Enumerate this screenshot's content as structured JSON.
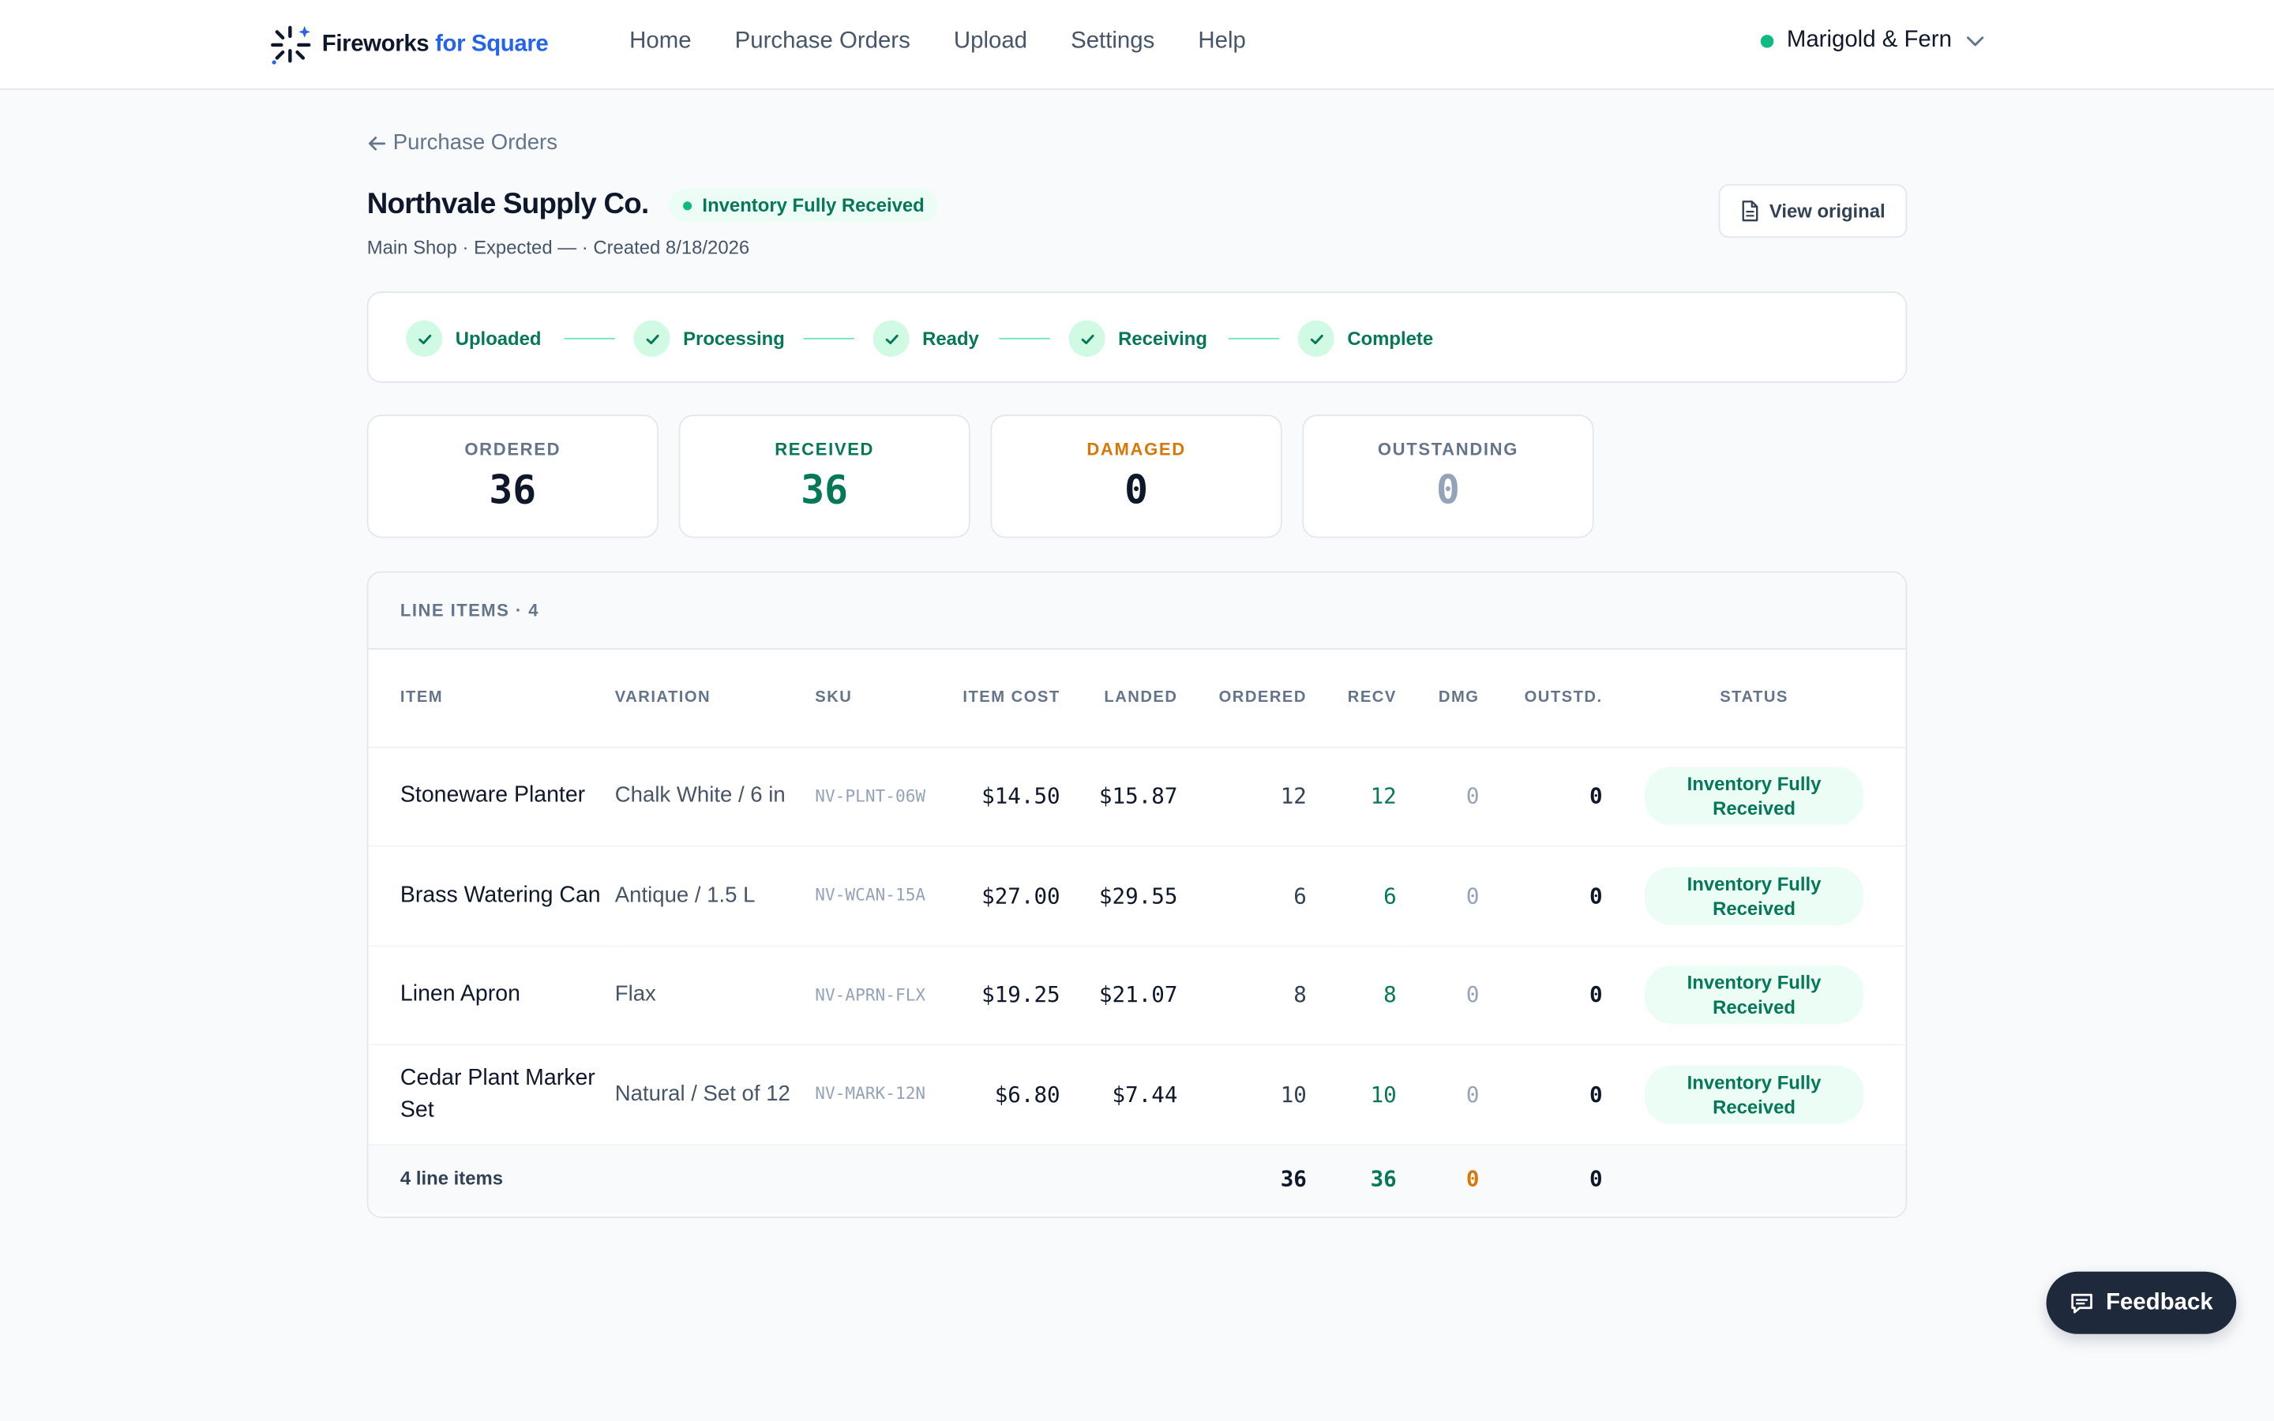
{
  "brand": {
    "name": "Fireworks",
    "accent": "for Square"
  },
  "nav": [
    "Home",
    "Purchase Orders",
    "Upload",
    "Settings",
    "Help"
  ],
  "account": {
    "name": "Marigold & Fern"
  },
  "back_link": "Purchase Orders",
  "header": {
    "title": "Northvale Supply Co.",
    "status": "Inventory Fully Received",
    "subtitle": "Main Shop · Expected — · Created 8/18/2026",
    "view_original": "View original"
  },
  "steps": [
    "Uploaded",
    "Processing",
    "Ready",
    "Receiving",
    "Complete"
  ],
  "stats": {
    "ordered": {
      "label": "ORDERED",
      "value": "36"
    },
    "received": {
      "label": "RECEIVED",
      "value": "36"
    },
    "damaged": {
      "label": "DAMAGED",
      "value": "0"
    },
    "outstanding": {
      "label": "OUTSTANDING",
      "value": "0"
    }
  },
  "table": {
    "title": "LINE ITEMS · 4",
    "columns": {
      "item": "ITEM",
      "variation": "VARIATION",
      "sku": "SKU",
      "item_cost": "ITEM COST",
      "landed": "LANDED",
      "ordered": "ORDERED",
      "recv": "RECV",
      "dmg": "DMG",
      "outstd": "OUTSTD.",
      "status": "STATUS"
    },
    "rows": [
      {
        "item": "Stoneware Planter",
        "variation": "Chalk White / 6 in",
        "sku": "NV-PLNT-06W",
        "cost": "$14.50",
        "landed": "$15.87",
        "ordered": "12",
        "recv": "12",
        "dmg": "0",
        "out": "0",
        "status": "Inventory Fully Received"
      },
      {
        "item": "Brass Watering Can",
        "variation": "Antique / 1.5 L",
        "sku": "NV-WCAN-15A",
        "cost": "$27.00",
        "landed": "$29.55",
        "ordered": "6",
        "recv": "6",
        "dmg": "0",
        "out": "0",
        "status": "Inventory Fully Received"
      },
      {
        "item": "Linen Apron",
        "variation": "Flax",
        "sku": "NV-APRN-FLX",
        "cost": "$19.25",
        "landed": "$21.07",
        "ordered": "8",
        "recv": "8",
        "dmg": "0",
        "out": "0",
        "status": "Inventory Fully Received"
      },
      {
        "item": "Cedar Plant Marker Set",
        "variation": "Natural / Set of 12",
        "sku": "NV-MARK-12N",
        "cost": "$6.80",
        "landed": "$7.44",
        "ordered": "10",
        "recv": "10",
        "dmg": "0",
        "out": "0",
        "status": "Inventory Fully Received"
      }
    ],
    "footer": {
      "label": "4 line items",
      "ordered": "36",
      "recv": "36",
      "dmg": "0",
      "out": "0"
    }
  },
  "feedback": "Feedback",
  "colors": {
    "brand_blue": "#2563eb",
    "success": "#047857",
    "warning": "#d97706",
    "dark": "#1e293b"
  }
}
